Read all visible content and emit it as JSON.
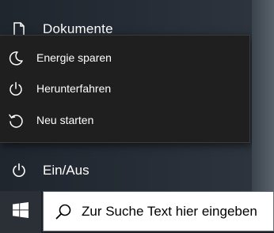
{
  "start_menu": {
    "documents_label": "Dokumente",
    "power_label": "Ein/Aus"
  },
  "power_flyout": {
    "items": [
      {
        "label": "Energie sparen",
        "icon": "moon-icon"
      },
      {
        "label": "Herunterfahren",
        "icon": "power-icon"
      },
      {
        "label": "Neu starten",
        "icon": "restart-icon"
      }
    ]
  },
  "taskbar": {
    "start_icon": "windows-logo-icon",
    "search_placeholder": "Zur Suche Text hier eingeben",
    "search_icon": "search-icon"
  },
  "colors": {
    "menu_bg": "#252c35",
    "flyout_bg": "#1f1f1f",
    "taskbar_bg": "#1d2026",
    "search_bg": "#ffffff",
    "text": "#ffffff"
  }
}
